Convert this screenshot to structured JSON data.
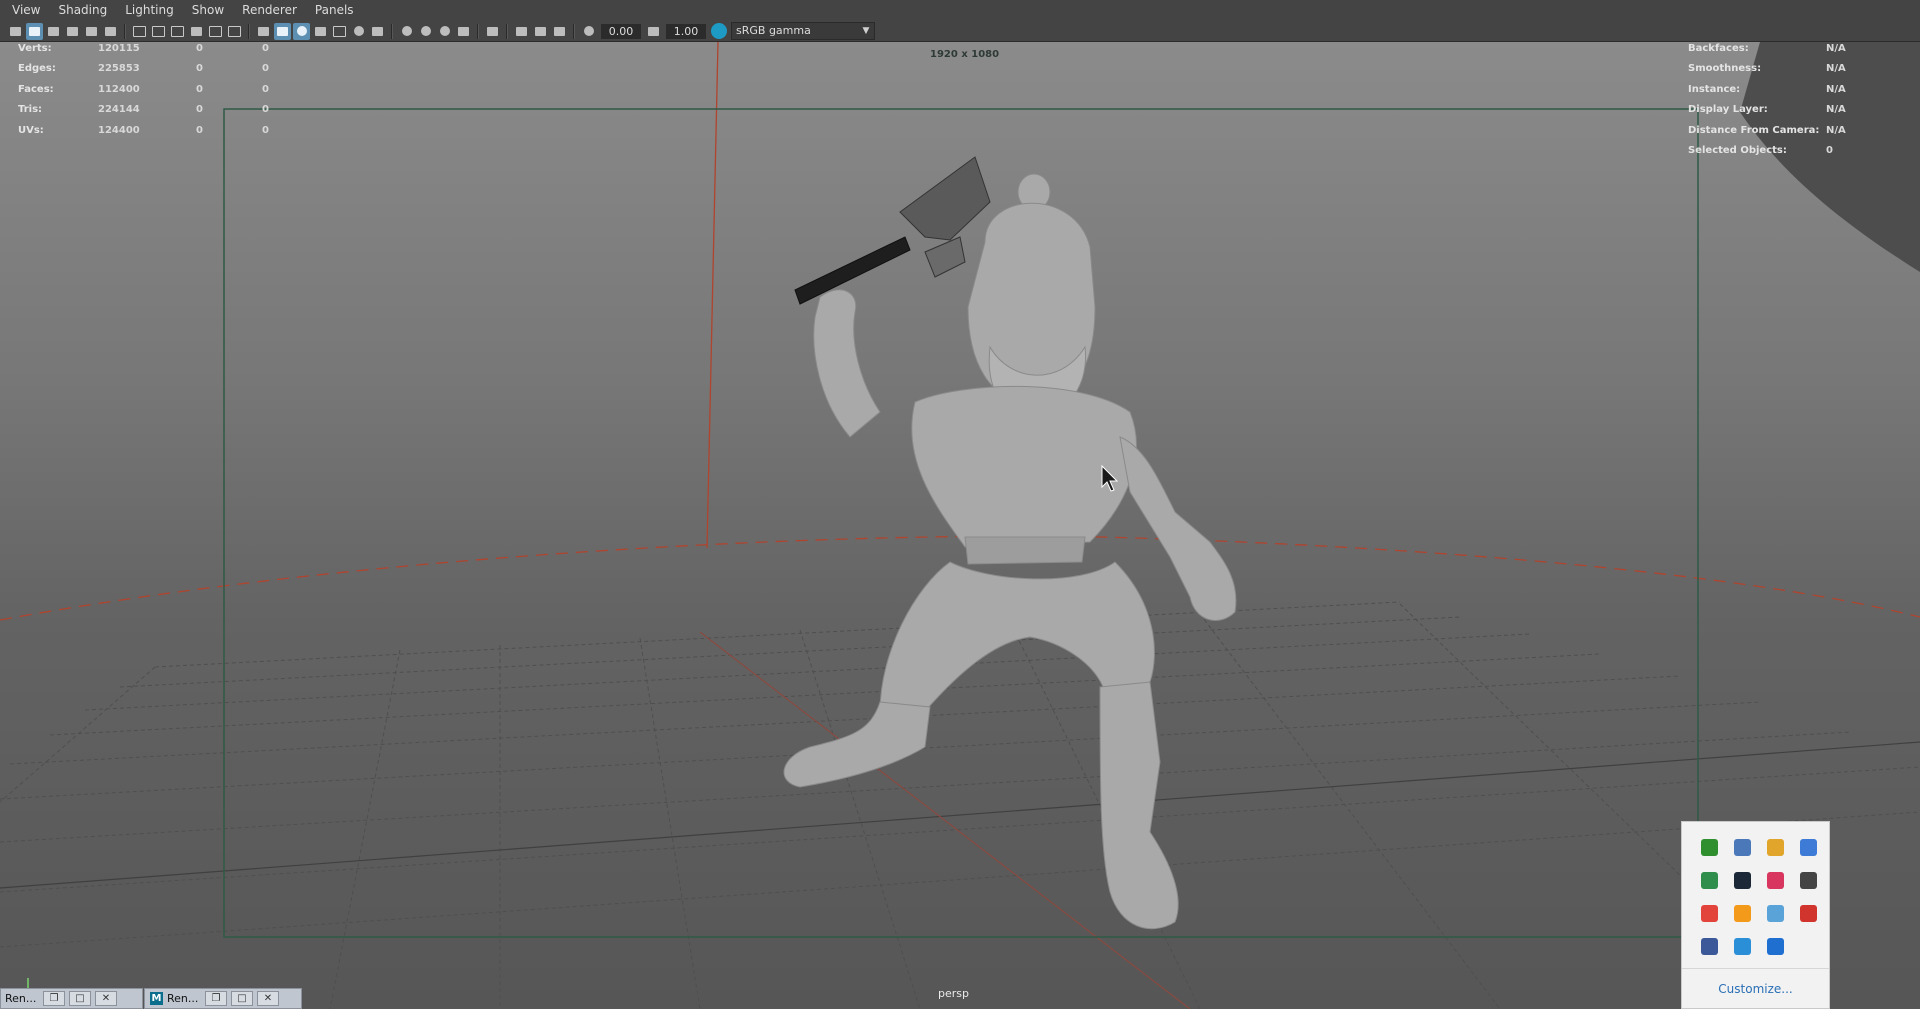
{
  "menu": [
    "View",
    "Shading",
    "Lighting",
    "Show",
    "Renderer",
    "Panels"
  ],
  "toolbar": {
    "exposure": "0.00",
    "gamma": "1.00",
    "colorspace": "sRGB gamma",
    "icons": [
      "select-camera-icon",
      "camera-attributes-icon",
      "bookmark-icon",
      "image-plane-icon",
      "grease-pencil-icon",
      "grid-icon",
      "film-gate-icon",
      "resolution-gate-icon",
      "gate-mask-icon",
      "field-chart-icon",
      "safe-action-icon",
      "safe-title-icon",
      "wireframe-icon",
      "smooth-shade-icon",
      "default-material-icon",
      "wireframe-on-shaded-icon",
      "xray-icon",
      "use-lights-icon",
      "shadows-icon",
      "screen-space-ao-icon",
      "motion-blur-icon",
      "multisample-aa-icon",
      "depth-of-field-icon",
      "isolate-select-icon",
      "xray-joints-icon",
      "xray-active-icon",
      "backface-icon",
      "exposure-icon",
      "gamma-icon",
      "color-management-icon"
    ]
  },
  "hud_left": [
    {
      "label": "Verts:",
      "v1": "120115",
      "v2": "0",
      "v3": "0"
    },
    {
      "label": "Edges:",
      "v1": "225853",
      "v2": "0",
      "v3": "0"
    },
    {
      "label": "Faces:",
      "v1": "112400",
      "v2": "0",
      "v3": "0"
    },
    {
      "label": "Tris:",
      "v1": "224144",
      "v2": "0",
      "v3": "0"
    },
    {
      "label": "UVs:",
      "v1": "124400",
      "v2": "0",
      "v3": "0"
    }
  ],
  "hud_right": [
    {
      "label": "Backfaces:",
      "value": "N/A"
    },
    {
      "label": "Smoothness:",
      "value": "N/A"
    },
    {
      "label": "Instance:",
      "value": "N/A"
    },
    {
      "label": "Display Layer:",
      "value": "N/A"
    },
    {
      "label": "Distance From Camera:",
      "value": "N/A"
    },
    {
      "label": "Selected Objects:",
      "value": "0"
    }
  ],
  "resolution_label": "1920 x 1080",
  "camera_label": "persp",
  "taskbar": [
    {
      "title": "Ren..."
    },
    {
      "title": "Ren..."
    }
  ],
  "tray": {
    "icons": [
      {
        "name": "nvidia-icon",
        "color": "#2f8f2f"
      },
      {
        "name": "snipping-tool-icon",
        "color": "#4a78b8"
      },
      {
        "name": "chrome-icon",
        "color": "#e0a52a"
      },
      {
        "name": "qbittorrent-icon",
        "color": "#3d7bd6"
      },
      {
        "name": "green-app-icon",
        "color": "#2f8e4b"
      },
      {
        "name": "steam-icon",
        "color": "#1b2838"
      },
      {
        "name": "heart-app-icon",
        "color": "#d8355f"
      },
      {
        "name": "camera-app-icon",
        "color": "#444444"
      },
      {
        "name": "red-s-app-icon",
        "color": "#e2443b"
      },
      {
        "name": "orange-app-icon",
        "color": "#f39a1b"
      },
      {
        "name": "network-app-icon",
        "color": "#5aa3d8"
      },
      {
        "name": "red-dots-app-icon",
        "color": "#d0342c"
      },
      {
        "name": "usb-app-icon",
        "color": "#3b5998"
      },
      {
        "name": "blue-circle-app-icon",
        "color": "#2b8fd8"
      },
      {
        "name": "teamviewer-icon",
        "color": "#1e6fd0"
      }
    ],
    "customize": "Customize..."
  }
}
